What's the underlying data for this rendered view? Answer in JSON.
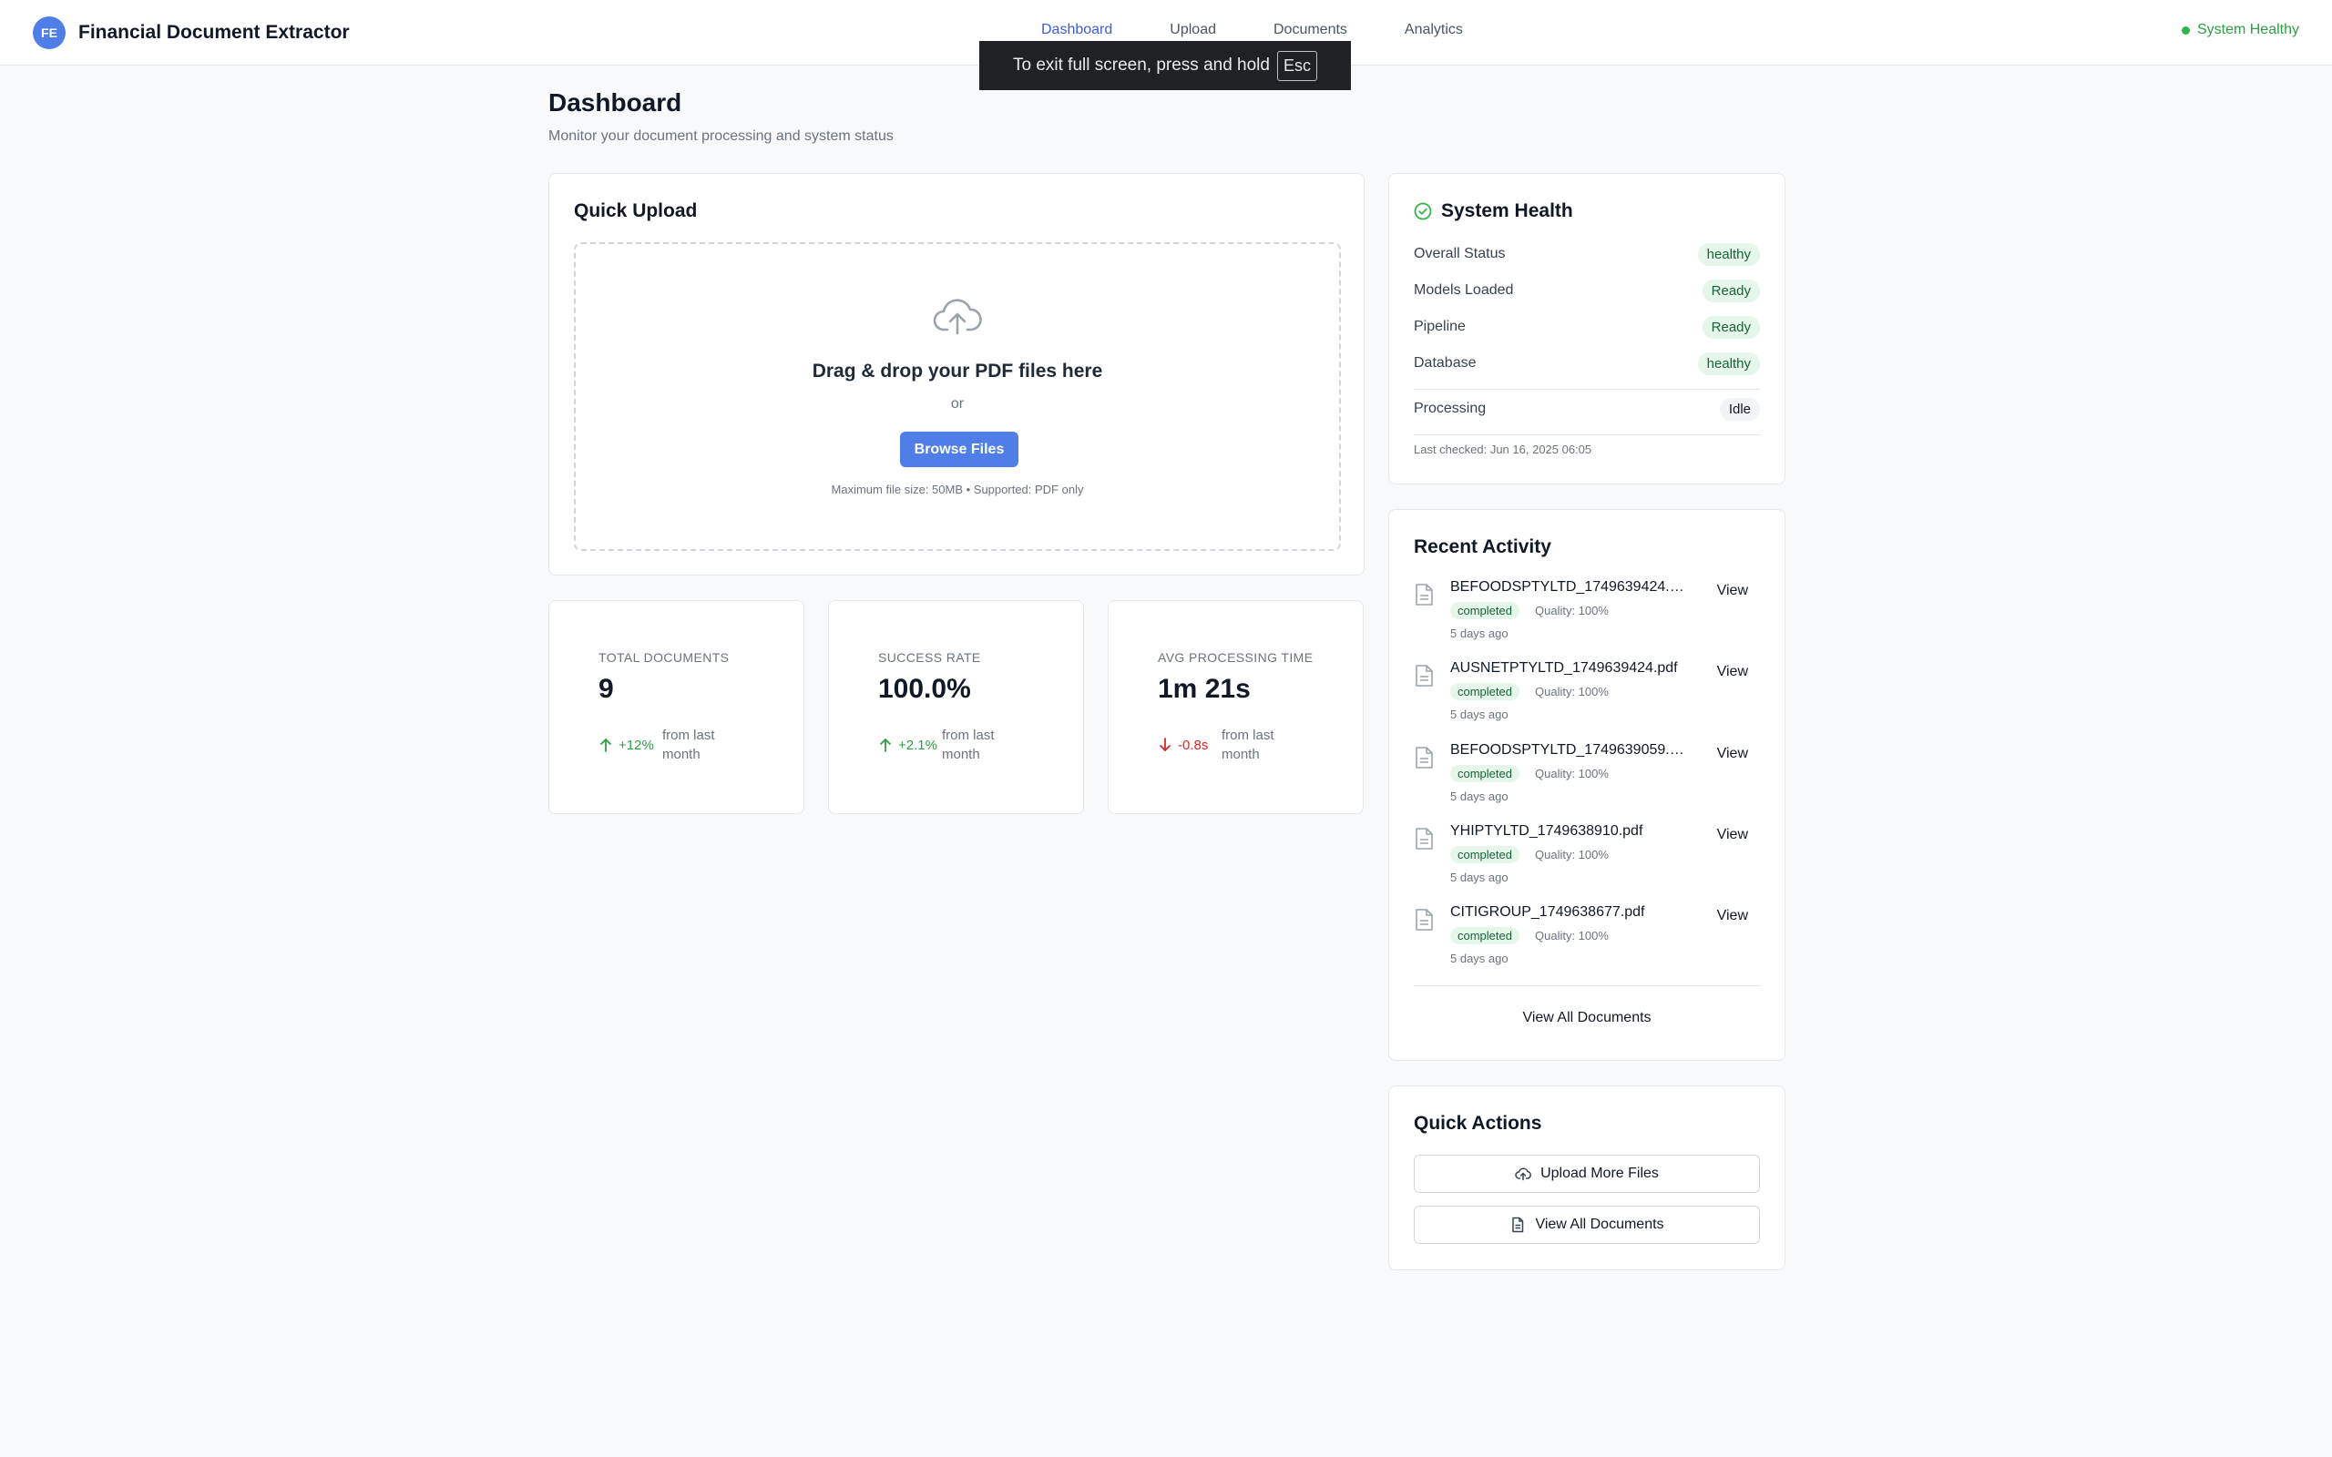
{
  "app": {
    "logo_initials": "FE",
    "name": "Financial Document Extractor",
    "status_text": "System Healthy",
    "status_color": "#34b34a"
  },
  "nav": {
    "items": [
      "Dashboard",
      "Upload",
      "Documents",
      "Analytics"
    ],
    "active": "Dashboard"
  },
  "fullscreen_toast": {
    "text": "To exit full screen, press and hold",
    "key": "Esc"
  },
  "page": {
    "title": "Dashboard",
    "subtitle": "Monitor your document processing and system status"
  },
  "upload": {
    "title": "Quick Upload",
    "drop_text": "Drag & drop your PDF files here",
    "or_text": "or",
    "browse_label": "Browse Files",
    "note": "Maximum file size: 50MB • Supported: PDF only",
    "accent": "#4f7fe6"
  },
  "stats": [
    {
      "label": "TOTAL DOCUMENTS",
      "value": "9",
      "trend": "+12%",
      "direction": "up",
      "note": "from last month"
    },
    {
      "label": "SUCCESS RATE",
      "value": "100.0%",
      "trend": "+2.1%",
      "direction": "up",
      "note": "from last month"
    },
    {
      "label": "AVG PROCESSING TIME",
      "value": "1m 21s",
      "trend": "-0.8s",
      "direction": "down",
      "note": "from last month"
    }
  ],
  "health": {
    "title": "System Health",
    "rows": [
      {
        "label": "Overall Status",
        "value": "healthy"
      },
      {
        "label": "Models Loaded",
        "value": "Ready"
      },
      {
        "label": "Pipeline",
        "value": "Ready"
      },
      {
        "label": "Database",
        "value": "healthy"
      }
    ],
    "processing": {
      "label": "Processing",
      "value": "Idle"
    },
    "last_checked": "Last checked: Jun 16, 2025 06:05"
  },
  "activity": {
    "title": "Recent Activity",
    "items": [
      {
        "name": "BEFOODSPTYLTD_1749639424.p...",
        "status": "completed",
        "quality": "Quality: 100%",
        "time": "5 days ago",
        "action": "View"
      },
      {
        "name": "AUSNETPTYLTD_1749639424.pdf",
        "status": "completed",
        "quality": "Quality: 100%",
        "time": "5 days ago",
        "action": "View"
      },
      {
        "name": "BEFOODSPTYLTD_1749639059.p...",
        "status": "completed",
        "quality": "Quality: 100%",
        "time": "5 days ago",
        "action": "View"
      },
      {
        "name": "YHIPTYLTD_1749638910.pdf",
        "status": "completed",
        "quality": "Quality: 100%",
        "time": "5 days ago",
        "action": "View"
      },
      {
        "name": "CITIGROUP_1749638677.pdf",
        "status": "completed",
        "quality": "Quality: 100%",
        "time": "5 days ago",
        "action": "View"
      }
    ],
    "view_all": "View All Documents"
  },
  "quick_actions": {
    "title": "Quick Actions",
    "upload_more": "Upload More Files",
    "view_all": "View All Documents"
  },
  "icons": {
    "brand": "brand-logo",
    "status": "status-dot-icon",
    "upload": "cloud-upload-icon",
    "health": "check-circle-icon",
    "file": "file-icon",
    "trend_up": "arrow-up-icon",
    "trend_down": "arrow-down-icon"
  }
}
